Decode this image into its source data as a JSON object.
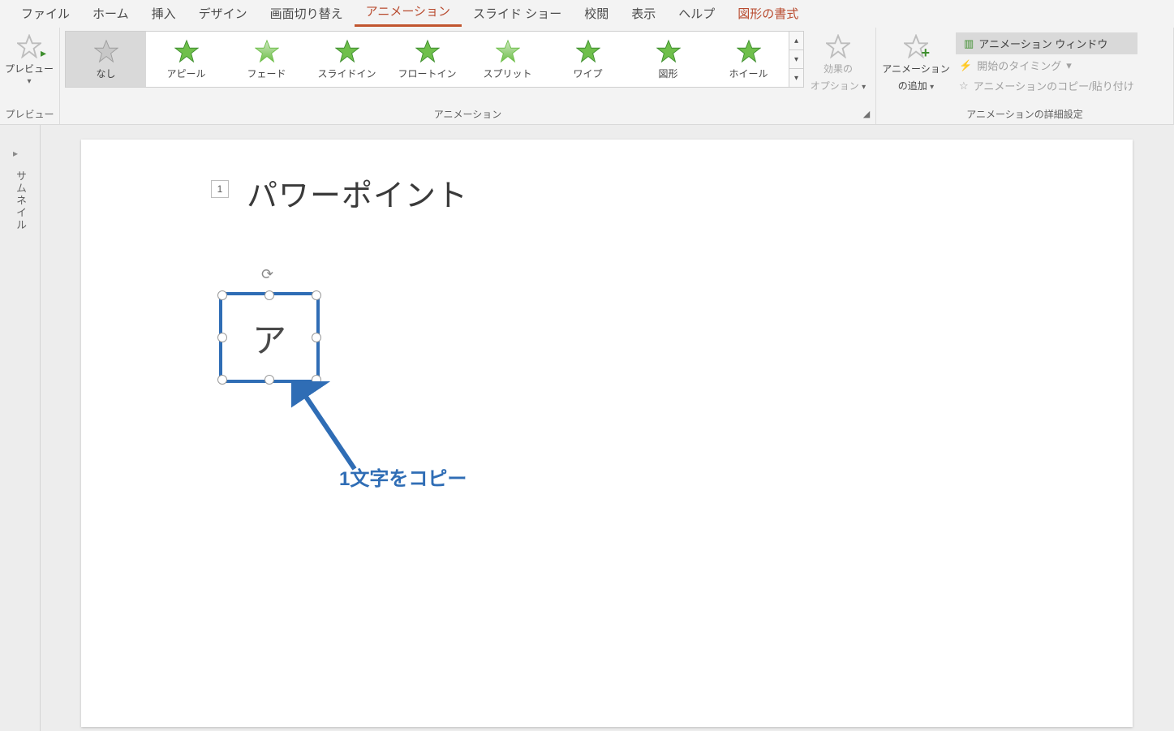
{
  "tabs": {
    "file": "ファイル",
    "home": "ホーム",
    "insert": "挿入",
    "design": "デザイン",
    "transitions": "画面切り替え",
    "animations": "アニメーション",
    "slideshow": "スライド ショー",
    "review": "校閲",
    "view": "表示",
    "help": "ヘルプ",
    "shape_format": "図形の書式"
  },
  "ribbon": {
    "preview": {
      "label": "プレビュー",
      "group_label": "プレビュー"
    },
    "gallery": {
      "items": [
        {
          "label": "なし",
          "style": "gray",
          "selected": true
        },
        {
          "label": "アピール",
          "style": "green"
        },
        {
          "label": "フェード",
          "style": "green-fade"
        },
        {
          "label": "スライドイン",
          "style": "green"
        },
        {
          "label": "フロートイン",
          "style": "green"
        },
        {
          "label": "スプリット",
          "style": "green-fade"
        },
        {
          "label": "ワイプ",
          "style": "green"
        },
        {
          "label": "図形",
          "style": "green"
        },
        {
          "label": "ホイール",
          "style": "green"
        }
      ],
      "group_label": "アニメーション"
    },
    "effect_options": {
      "line1": "効果の",
      "line2": "オプション"
    },
    "add_animation": {
      "line1": "アニメーション",
      "line2": "の追加"
    },
    "advanced": {
      "pane": "アニメーション ウィンドウ",
      "trigger": "開始のタイミング",
      "painter": "アニメーションのコピー/貼り付け",
      "group_label": "アニメーションの詳細設定"
    }
  },
  "side": {
    "label": "サムネイル"
  },
  "slide": {
    "anim_order": "1",
    "title": "パワーポイント",
    "shape_text": "ア",
    "annotation": "1文字をコピー"
  }
}
